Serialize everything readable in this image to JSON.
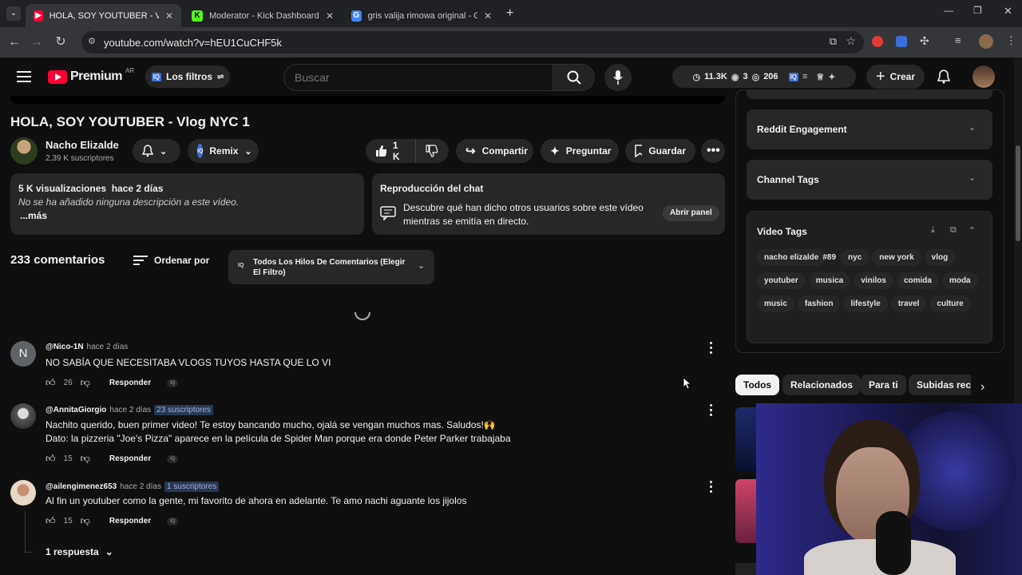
{
  "browser": {
    "tabs": [
      {
        "title": "HOLA, SOY YOUTUBER - Vlog N",
        "active": true
      },
      {
        "title": "Moderator - Kick Dashboard",
        "active": false
      },
      {
        "title": "gris valija rimowa original - Goo",
        "active": false
      }
    ],
    "url": "youtube.com/watch?v=hEU1CuCHF5k"
  },
  "header": {
    "logo": "Premium",
    "country": "AR",
    "filters_label": "Los filtros",
    "search_placeholder": "Buscar",
    "stats": {
      "views": "11.3K",
      "eye": "3",
      "count": "206"
    },
    "create_label": "Crear"
  },
  "video": {
    "title": "HOLA, SOY YOUTUBER - Vlog NYC 1",
    "channel": "Nacho Elizalde",
    "subscribers": "2,39 K suscriptores",
    "remix_label": "Remix",
    "likes": "1 K",
    "share_label": "Compartir",
    "ask_label": "Preguntar",
    "save_label": "Guardar"
  },
  "description": {
    "meta": "5 K visualizaciones  hace 2 días",
    "text": "No se ha añadido ninguna descripción a este vídeo.",
    "more": "...más"
  },
  "chat_replay": {
    "title": "Reproducción del chat",
    "text_line1": "Descubre qué han dicho otros usuarios sobre este vídeo",
    "text_line2": "mientras se emitía en directo.",
    "open_label": "Abrir panel"
  },
  "comments_header": {
    "count": "233 comentarios",
    "sort_label": "Ordenar por",
    "filter_line1": "Todos Los Hilos De Comentarios (Elegir",
    "filter_line2": "El Filtro)"
  },
  "comments": [
    {
      "author": "@Nico-1N",
      "time": "hace 2 días",
      "subs": "",
      "text": "NO SABÍA QUE NECESITABA VLOGS TUYOS HASTA QUE LO VI",
      "text2": "",
      "likes": "26",
      "reply": "Responder",
      "avatar_letter": "N"
    },
    {
      "author": "@AnnitaGiorgio",
      "time": "hace 2 días",
      "subs": "23 suscriptores",
      "text": "Nachito querido, buen primer video! Te estoy bancando mucho, ojalá se vengan muchos mas. Saludos!🙌",
      "text2": "Dato: la pizzeria \"Joe's Pizza\" aparece en la película de Spider Man porque era donde Peter Parker trabajaba",
      "likes": "15",
      "reply": "Responder",
      "avatar_letter": ""
    },
    {
      "author": "@ailengimenez653",
      "time": "hace 2 días",
      "subs": "1 suscriptores",
      "text": "Al fin un youtuber como la gente, mi favorito de ahora en adelante. Te amo nachi aguante los jijolos",
      "text2": "",
      "likes": "15",
      "reply": "Responder",
      "avatar_letter": ""
    }
  ],
  "replies_label": "1 respuesta",
  "sidebar": {
    "reddit": "Reddit Engagement",
    "channel_tags": "Channel Tags",
    "video_tags": "Video Tags",
    "tags": [
      "nacho elizalde",
      "#89",
      "nyc",
      "new york",
      "vlog",
      "youtuber",
      "musica",
      "vinilos",
      "comida",
      "moda",
      "music",
      "fashion",
      "lifestyle",
      "travel",
      "culture"
    ]
  },
  "chips": [
    "Todos",
    "Relacionados",
    "Para ti",
    "Subidas rec"
  ]
}
